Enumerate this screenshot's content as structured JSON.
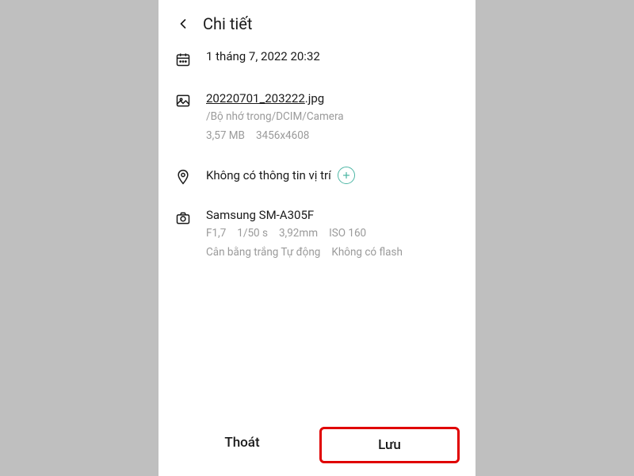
{
  "header": {
    "title": "Chi tiết"
  },
  "date": {
    "text": "1 tháng 7, 2022 20:32"
  },
  "file": {
    "name": "20220701_203222",
    "ext": ".jpg",
    "path": "/Bộ nhớ trong/DCIM/Camera",
    "size": "3,57 MB",
    "dimensions": "3456x4608"
  },
  "location": {
    "text": "Không có thông tin vị trí"
  },
  "camera": {
    "model": "Samsung SM-A305F",
    "aperture": "F1,7",
    "shutter": "1/50 s",
    "focal": "3,92mm",
    "iso": "ISO 160",
    "wb": "Cân bằng trắng Tự động",
    "flash": "Không có flash"
  },
  "footer": {
    "cancel": "Thoát",
    "save": "Lưu"
  }
}
